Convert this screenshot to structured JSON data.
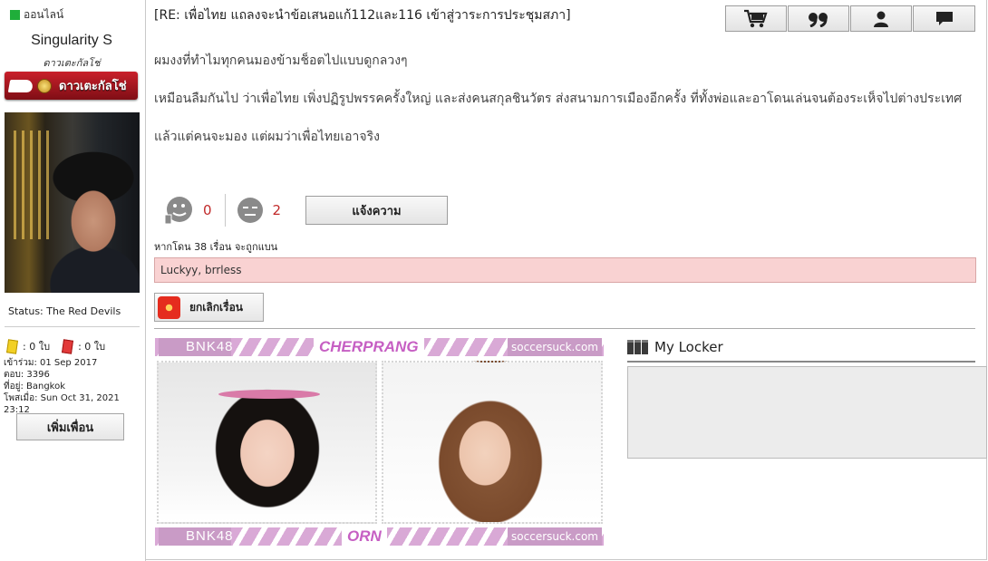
{
  "sidebar": {
    "online_label": "ออนไลน์",
    "username": "Singularity S",
    "user_title": "ดาวเตะกัลโช่",
    "rank_badge": "ดาวเตะกัลโช่",
    "status": "Status: The Red Devils",
    "yellow_cards": ": 0 ใบ",
    "red_cards": ": 0 ใบ",
    "joined": "เข้าร่วม: 01 Sep 2017",
    "replies": "ตอบ: 3396",
    "location": "ที่อยู่: Bangkok",
    "posted": "โพสเมื่อ: Sun Oct 31, 2021 23:12",
    "add_friend": "เพิ่มเพื่อน"
  },
  "post": {
    "title": "[RE: เพื่อไทย แถลงจะนำข้อเสนอแก้112และ116 เข้าสู่วาระการประชุมสภา]",
    "paragraphs": [
      "ผมงงที่ทำไมทุกคนมองข้ามช็อตไปแบบดูกลวงๆ",
      "เหมือนลืมกันไป ว่าเพื่อไทย เพิ่งปฏิรูปพรรคครั้งใหญ่ และส่งคนสกุลชินวัตร ส่งสนามการเมืองอีกครั้ง ที่ทั้งพ่อและอาโดนเล่นจนต้องระเห็จไปต่างประเทศ",
      "แล้วแต่คนจะมอง แต่ผมว่าเพื่อไทยเอาจริง"
    ]
  },
  "toolbar": {
    "icons": [
      "cart-icon",
      "quote-icon",
      "user-icon",
      "message-icon"
    ]
  },
  "votes": {
    "like_count": "0",
    "dislike_count": "2",
    "report_label": "แจ้งความ"
  },
  "ban": {
    "note": "หากโดน 38 เรื่อน จะถูกแบน",
    "reporters": "Luckyy, brrless",
    "cancel_label": "ยกเลิกเรื่อน"
  },
  "signature": {
    "brand": "BNK48",
    "top_name": "CHERPRANG",
    "bottom_name": "ORN",
    "site": "soccersuck.com"
  },
  "locker": {
    "title": "My Locker"
  },
  "colors": {
    "online": "#1fae3a",
    "count": "#c12a2a",
    "reporters_bg": "#f9d2d2",
    "signature_pink": "#c65fc3"
  }
}
